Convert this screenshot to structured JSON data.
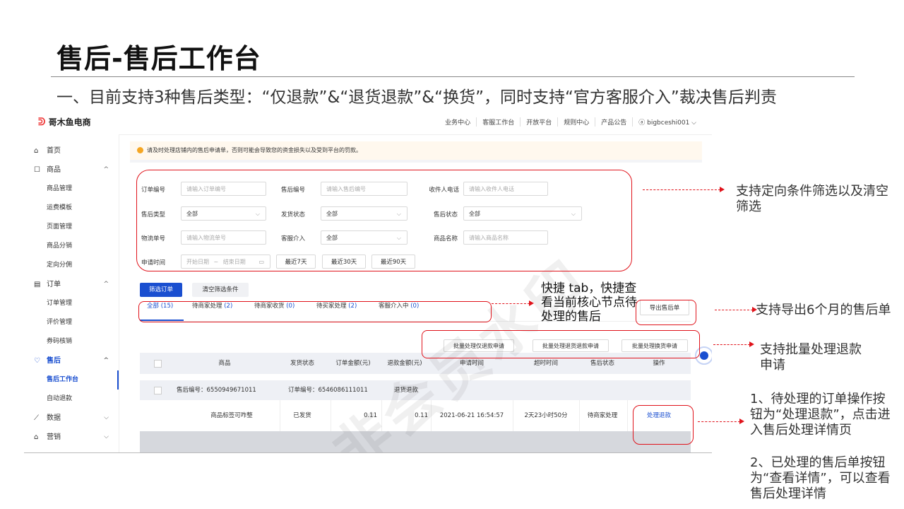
{
  "slide": {
    "title": "售后-售后工作台",
    "subtitle": "一、目前支持3种售后类型：“仅退款”&“退货退款”&“换货”，同时支持“官方客服介入”裁决售后判责"
  },
  "app": {
    "logo_text": "哥木鱼电商",
    "topnav": [
      "业务中心",
      "客服工作台",
      "开放平台",
      "规则中心",
      "产品公告",
      "ⓐ bigbceshi001 ⌵"
    ]
  },
  "sidebar": {
    "items": [
      {
        "label": "首页",
        "type": "group",
        "icon": "⌂"
      },
      {
        "label": "商品",
        "type": "group",
        "icon": "☐",
        "caret": "^"
      },
      {
        "label": "商品管理",
        "type": "sub"
      },
      {
        "label": "运费模板",
        "type": "sub"
      },
      {
        "label": "页面管理",
        "type": "sub"
      },
      {
        "label": "商品分销",
        "type": "sub"
      },
      {
        "label": "定向分佣",
        "type": "sub"
      },
      {
        "label": "订单",
        "type": "group",
        "icon": "▤",
        "caret": "^"
      },
      {
        "label": "订单管理",
        "type": "sub"
      },
      {
        "label": "评价管理",
        "type": "sub"
      },
      {
        "label": "券码核销",
        "type": "sub"
      },
      {
        "label": "售后",
        "type": "group",
        "icon": "♡",
        "caret": "^",
        "active": true
      },
      {
        "label": "售后工作台",
        "type": "sub",
        "current": true
      },
      {
        "label": "自动退款",
        "type": "sub"
      },
      {
        "label": "数据",
        "type": "group",
        "icon": "⟋",
        "caret": "⌵"
      },
      {
        "label": "营销",
        "type": "group",
        "icon": "⌂",
        "caret": "⌵"
      }
    ]
  },
  "notice": "请及时处理店铺内的售后申请单，否则可能会导致您的资金损失以及受到平台的罚款。",
  "filters": {
    "order_no": {
      "label": "订单编号",
      "placeholder": "请输入订单编号"
    },
    "aftersale_no": {
      "label": "售后编号",
      "placeholder": "请输入售后编号"
    },
    "receiver_phone": {
      "label": "收件人电话",
      "placeholder": "请输入收件人电话"
    },
    "aftersale_type": {
      "label": "售后类型",
      "value": "全部"
    },
    "ship_status": {
      "label": "发货状态",
      "value": "全部"
    },
    "aftersale_status": {
      "label": "售后状态",
      "value": "全部"
    },
    "logistics_no": {
      "label": "物流单号",
      "placeholder": "请输入物流单号"
    },
    "cs_intervention": {
      "label": "客服介入",
      "value": "全部"
    },
    "product_name": {
      "label": "商品名称",
      "placeholder": "请输入商品名称"
    },
    "apply_time": {
      "label": "申请时间",
      "start": "开始日期",
      "sep": "~",
      "end": "结束日期"
    },
    "quick_ranges": [
      "最近7天",
      "最近30天",
      "最近90天"
    ],
    "filter_button": "筛选订单",
    "clear_button": "清空筛选条件"
  },
  "tabs": [
    {
      "label": "全部",
      "count": "(15)"
    },
    {
      "label": "待商家处理",
      "count": "(2)"
    },
    {
      "label": "待商家收货",
      "count": "(0)"
    },
    {
      "label": "待买家处理",
      "count": "(2)"
    },
    {
      "label": "客服介入中",
      "count": "(0)"
    }
  ],
  "export_button": "导出售后单",
  "batch_buttons": [
    "批量处理仅退款申请",
    "批量处理退货退款申请",
    "批量处理换货申请"
  ],
  "table": {
    "headers": [
      "商品",
      "发货状态",
      "订单金额(元)",
      "退款金额(元)",
      "申请时间",
      "超时时间",
      "售后状态",
      "操作"
    ],
    "group": {
      "aftersale_no_label": "售后编号：",
      "aftersale_no": "6550949671011",
      "order_no_label": "订单编号：",
      "order_no": "6546086111011",
      "type": "退货退款"
    },
    "row": {
      "product": "商品标签可咋整",
      "ship_status": "已发货",
      "order_amount": "0.11",
      "refund_amount": "0.11",
      "apply_time": "2021-06-21 16:54:57",
      "timeout": "2天23小时50分",
      "status": "待商家处理",
      "action": "处理退款"
    }
  },
  "watermark": "非会员水印",
  "annotations": {
    "filter_note": "支持定向条件筛选以及清空筛选",
    "tab_note": "快捷 tab，快捷查看当前核心节点待处理的售后",
    "export_note": "支持导出6个月的售后单",
    "batch_note": "支持批量处理退款申请",
    "action_note_1": "1、待处理的订单操作按钮为“处理退款”，点击进入售后处理详情页",
    "action_note_2": "2、已处理的售后单按钮为“查看详情”，可以查看售后处理详情"
  },
  "colors": {
    "accent": "#1a4fd0",
    "highlight": "#e0131b",
    "warning": "#f5a623"
  }
}
